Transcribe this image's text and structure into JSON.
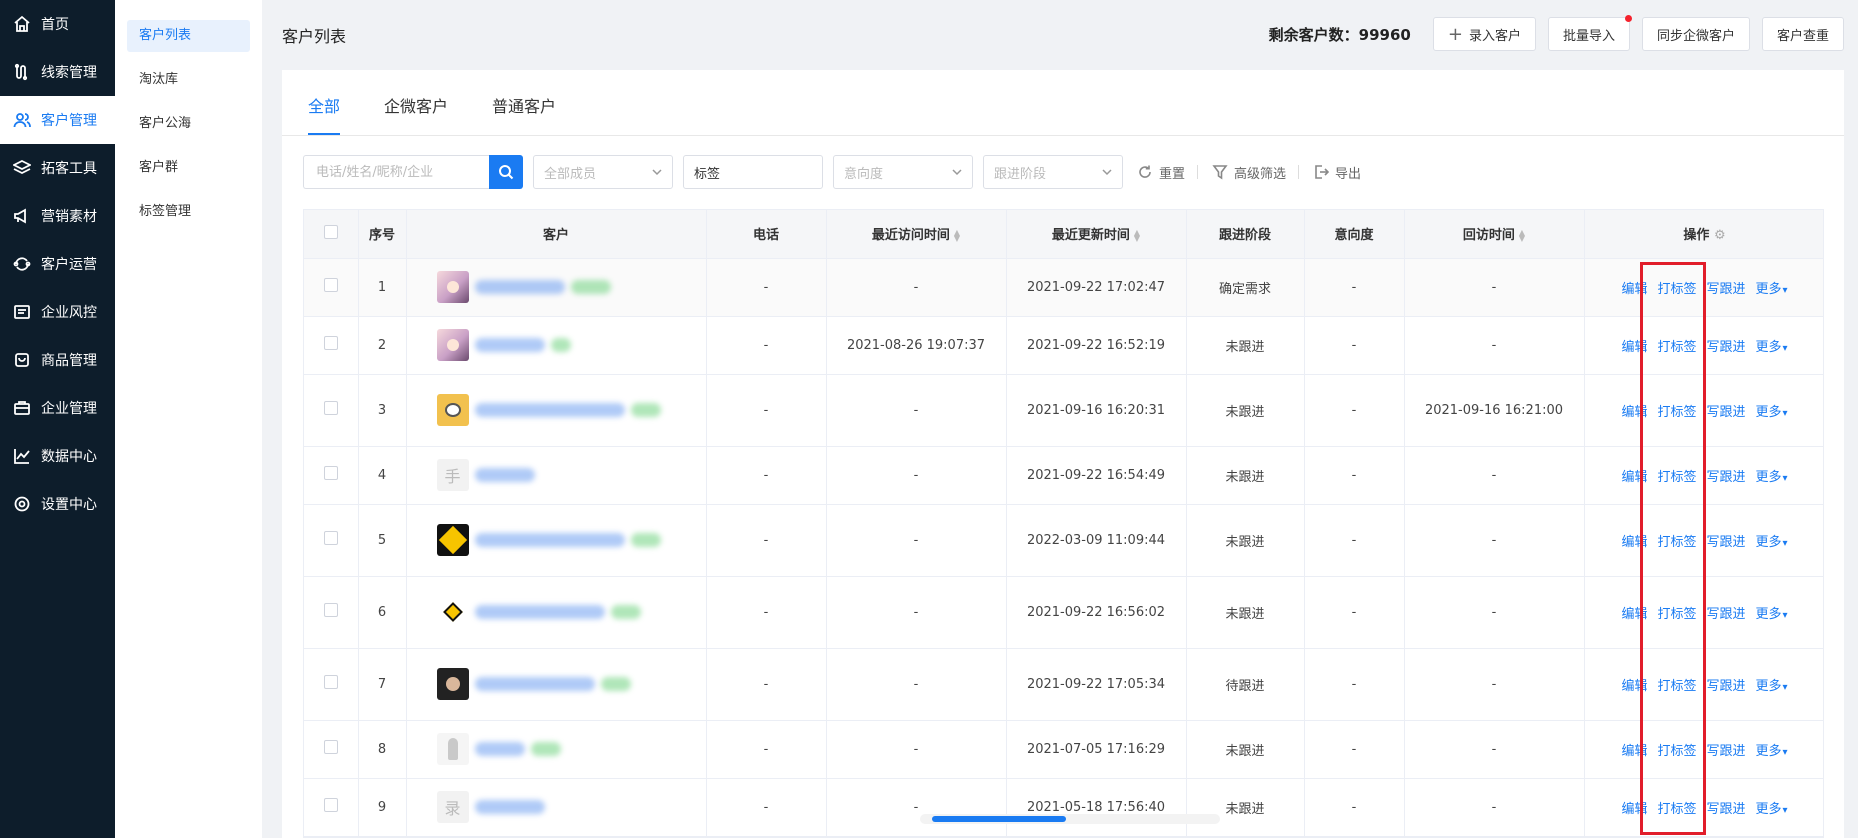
{
  "sidebar": {
    "items": [
      {
        "label": "首页",
        "icon": "home-icon",
        "active": false
      },
      {
        "label": "线索管理",
        "icon": "route-icon",
        "active": false
      },
      {
        "label": "客户管理",
        "icon": "users-icon",
        "active": true
      },
      {
        "label": "拓客工具",
        "icon": "layers-icon",
        "active": false
      },
      {
        "label": "营销素材",
        "icon": "megaphone-icon",
        "active": false
      },
      {
        "label": "客户运营",
        "icon": "cycle-icon",
        "active": false
      },
      {
        "label": "企业风控",
        "icon": "document-icon",
        "active": false
      },
      {
        "label": "商品管理",
        "icon": "bag-icon",
        "active": false
      },
      {
        "label": "企业管理",
        "icon": "briefcase-icon",
        "active": false
      },
      {
        "label": "数据中心",
        "icon": "chart-icon",
        "active": false
      },
      {
        "label": "设置中心",
        "icon": "gear-icon",
        "active": false
      }
    ]
  },
  "subnav": {
    "items": [
      {
        "label": "客户列表",
        "active": true
      },
      {
        "label": "淘汰库",
        "active": false
      },
      {
        "label": "客户公海",
        "active": false
      },
      {
        "label": "客户群",
        "active": false
      },
      {
        "label": "标签管理",
        "active": false
      }
    ]
  },
  "header": {
    "title": "客户列表",
    "remaining": "剩余客户数：99960",
    "add_label": "录入客户",
    "import_label": "批量导入",
    "sync_label": "同步企微客户",
    "dedupe_label": "客户查重"
  },
  "tabs": [
    {
      "label": "全部",
      "active": true
    },
    {
      "label": "企微客户",
      "active": false
    },
    {
      "label": "普通客户",
      "active": false
    }
  ],
  "filters": {
    "search_placeholder": "电话/姓名/昵称/企业",
    "members_placeholder": "全部成员",
    "tag_value": "标签",
    "intent_placeholder": "意向度",
    "stage_placeholder": "跟进阶段",
    "reset_label": "重置",
    "advanced_label": "高级筛选",
    "export_label": "导出"
  },
  "table": {
    "columns": [
      "序号",
      "客户",
      "电话",
      "最近访问时间",
      "最近更新时间",
      "跟进阶段",
      "意向度",
      "回访时间",
      "操作"
    ],
    "actions": {
      "edit": "编辑",
      "tag": "打标签",
      "follow": "写跟进",
      "more": "更多"
    },
    "rows": [
      {
        "no": "1",
        "avatar": "anime-girl",
        "avatar_text": "",
        "phone": "-",
        "visit": "-",
        "update": "2021-09-22 17:02:47",
        "stage": "确定需求",
        "intent": "-",
        "revisit": "-"
      },
      {
        "no": "2",
        "avatar": "anime-girl",
        "avatar_text": "",
        "phone": "-",
        "visit": "2021-08-26 19:07:37",
        "update": "2021-09-22 16:52:19",
        "stage": "未跟进",
        "intent": "-",
        "revisit": "-"
      },
      {
        "no": "3",
        "avatar": "cartoon",
        "avatar_text": "",
        "phone": "-",
        "visit": "-",
        "update": "2021-09-16 16:20:31",
        "stage": "未跟进",
        "intent": "-",
        "revisit": "2021-09-16 16:21:00"
      },
      {
        "no": "4",
        "avatar": "text",
        "avatar_text": "手",
        "phone": "-",
        "visit": "-",
        "update": "2021-09-22 16:54:49",
        "stage": "未跟进",
        "intent": "-",
        "revisit": "-"
      },
      {
        "no": "5",
        "avatar": "yellow-sign",
        "avatar_text": "",
        "phone": "-",
        "visit": "-",
        "update": "2022-03-09 11:09:44",
        "stage": "未跟进",
        "intent": "-",
        "revisit": "-"
      },
      {
        "no": "6",
        "avatar": "yellow-sign-small",
        "avatar_text": "",
        "phone": "-",
        "visit": "-",
        "update": "2021-09-22 16:56:02",
        "stage": "未跟进",
        "intent": "-",
        "revisit": "-"
      },
      {
        "no": "7",
        "avatar": "dark-person",
        "avatar_text": "",
        "phone": "-",
        "visit": "-",
        "update": "2021-09-22 17:05:34",
        "stage": "待跟进",
        "intent": "-",
        "revisit": "-"
      },
      {
        "no": "8",
        "avatar": "person-white",
        "avatar_text": "",
        "phone": "-",
        "visit": "-",
        "update": "2021-07-05 17:16:29",
        "stage": "未跟进",
        "intent": "-",
        "revisit": "-"
      },
      {
        "no": "9",
        "avatar": "text",
        "avatar_text": "录",
        "phone": "-",
        "visit": "-",
        "update": "2021-05-18 17:56:40",
        "stage": "未跟进",
        "intent": "-",
        "revisit": "-"
      }
    ]
  },
  "colors": {
    "accent": "#1a7bf2",
    "sidebar": "#0d1d2b",
    "highlight": "#e11d2a"
  }
}
